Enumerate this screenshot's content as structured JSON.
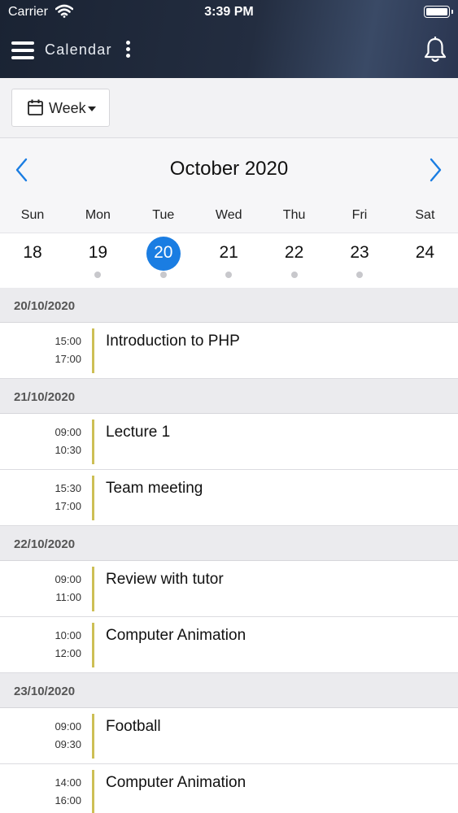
{
  "status_bar": {
    "carrier": "Carrier",
    "time": "3:39 PM"
  },
  "header": {
    "title": "Calendar",
    "menu_icon": "hamburger-icon",
    "more_icon": "kebab-icon",
    "bell_icon": "bell-icon"
  },
  "view_selector": {
    "label": "Week",
    "icon": "calendar-icon"
  },
  "calendar": {
    "month": "October 2020",
    "prev_icon": "chevron-left-icon",
    "next_icon": "chevron-right-icon",
    "accent_color": "#1a7de2",
    "days_of_week": [
      "Sun",
      "Mon",
      "Tue",
      "Wed",
      "Thu",
      "Fri",
      "Sat"
    ],
    "dates": [
      {
        "day": "18",
        "has_events": false,
        "selected": false
      },
      {
        "day": "19",
        "has_events": true,
        "selected": false
      },
      {
        "day": "20",
        "has_events": true,
        "selected": true
      },
      {
        "day": "21",
        "has_events": true,
        "selected": false
      },
      {
        "day": "22",
        "has_events": true,
        "selected": false
      },
      {
        "day": "23",
        "has_events": true,
        "selected": false
      },
      {
        "day": "24",
        "has_events": false,
        "selected": false
      }
    ]
  },
  "agenda": {
    "event_bar_color": "#cdbf55",
    "days": [
      {
        "date": "20/10/2020",
        "events": [
          {
            "start": "15:00",
            "end": "17:00",
            "title": "Introduction to PHP"
          }
        ]
      },
      {
        "date": "21/10/2020",
        "events": [
          {
            "start": "09:00",
            "end": "10:30",
            "title": "Lecture 1"
          },
          {
            "start": "15:30",
            "end": "17:00",
            "title": "Team meeting"
          }
        ]
      },
      {
        "date": "22/10/2020",
        "events": [
          {
            "start": "09:00",
            "end": "11:00",
            "title": "Review with tutor"
          },
          {
            "start": "10:00",
            "end": "12:00",
            "title": "Computer Animation"
          }
        ]
      },
      {
        "date": "23/10/2020",
        "events": [
          {
            "start": "09:00",
            "end": "09:30",
            "title": "Football"
          },
          {
            "start": "14:00",
            "end": "16:00",
            "title": "Computer Animation"
          }
        ]
      }
    ]
  }
}
